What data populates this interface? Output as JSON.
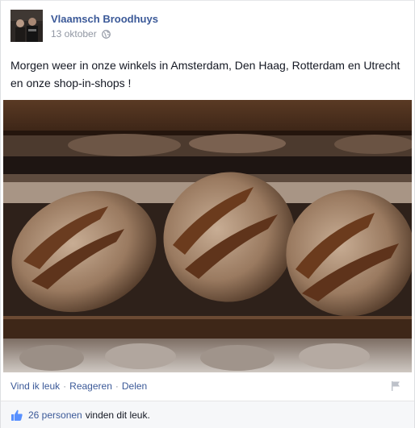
{
  "post": {
    "author": "Vlaamsch Broodhuys",
    "date": "13 oktober",
    "message": "Morgen weer in onze winkels in Amsterdam, Den Haag, Rotterdam en Utrecht en onze shop-in-shops !"
  },
  "actions": {
    "like": "Vind ik leuk",
    "comment": "Reageren",
    "share": "Delen",
    "separator": "·"
  },
  "likes": {
    "count": "26 personen",
    "suffix": "vinden dit leuk."
  },
  "icons": {
    "privacy": "globe-icon",
    "report": "flag-icon",
    "like": "thumbs-up-icon"
  },
  "colors": {
    "link": "#3b5998",
    "meta": "#9197a3",
    "text": "#141823"
  }
}
